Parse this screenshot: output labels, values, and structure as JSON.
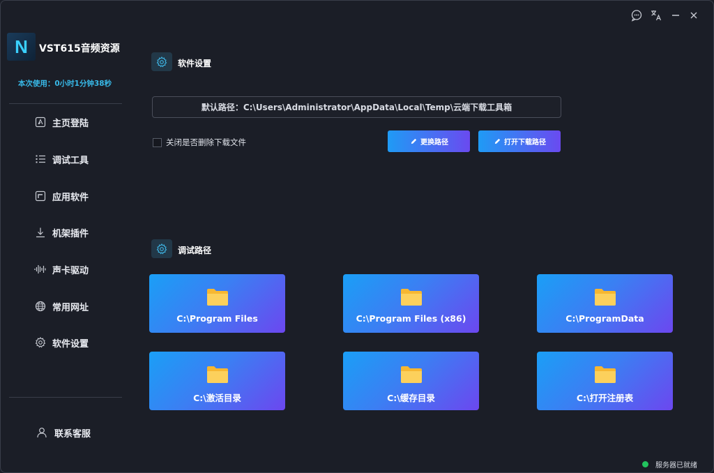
{
  "app": {
    "logo_letter": "N",
    "title": "VST615音频资源",
    "usage_text": "本次使用：0小时1分钟38秒"
  },
  "sidebar": {
    "items": [
      {
        "label": "主页登陆",
        "icon": "home-icon"
      },
      {
        "label": "调试工具",
        "icon": "list-icon"
      },
      {
        "label": "应用软件",
        "icon": "app-icon"
      },
      {
        "label": "机架插件",
        "icon": "download-icon"
      },
      {
        "label": "声卡驱动",
        "icon": "waveform-icon"
      },
      {
        "label": "常用网址",
        "icon": "globe-icon"
      },
      {
        "label": "软件设置",
        "icon": "gear-icon"
      }
    ],
    "contact_label": "联系客服"
  },
  "settings": {
    "title": "软件设置",
    "path_label": "默认路径：",
    "path_value": "C:\\Users\\Administrator\\AppData\\Local\\Temp\\云端下载工具箱",
    "checkbox_label": "关闭是否删除下载文件",
    "checkbox_checked": false,
    "change_path_button": "更换路径",
    "open_download_button": "打开下载路径"
  },
  "debug": {
    "title": "调试路径",
    "folders": [
      "C:\\Program Files",
      "C:\\Program Files (x86)",
      "C:\\ProgramData",
      "C:\\激活目录",
      "C:\\缓存目录",
      "C:\\打开注册表"
    ]
  },
  "status": {
    "text": "服务器已就绪",
    "color": "#22c35e"
  },
  "colors": {
    "accent_start": "#1a9ff6",
    "accent_end": "#6c47ef",
    "background": "#1b1e27",
    "usage_text": "#38b9e8"
  }
}
